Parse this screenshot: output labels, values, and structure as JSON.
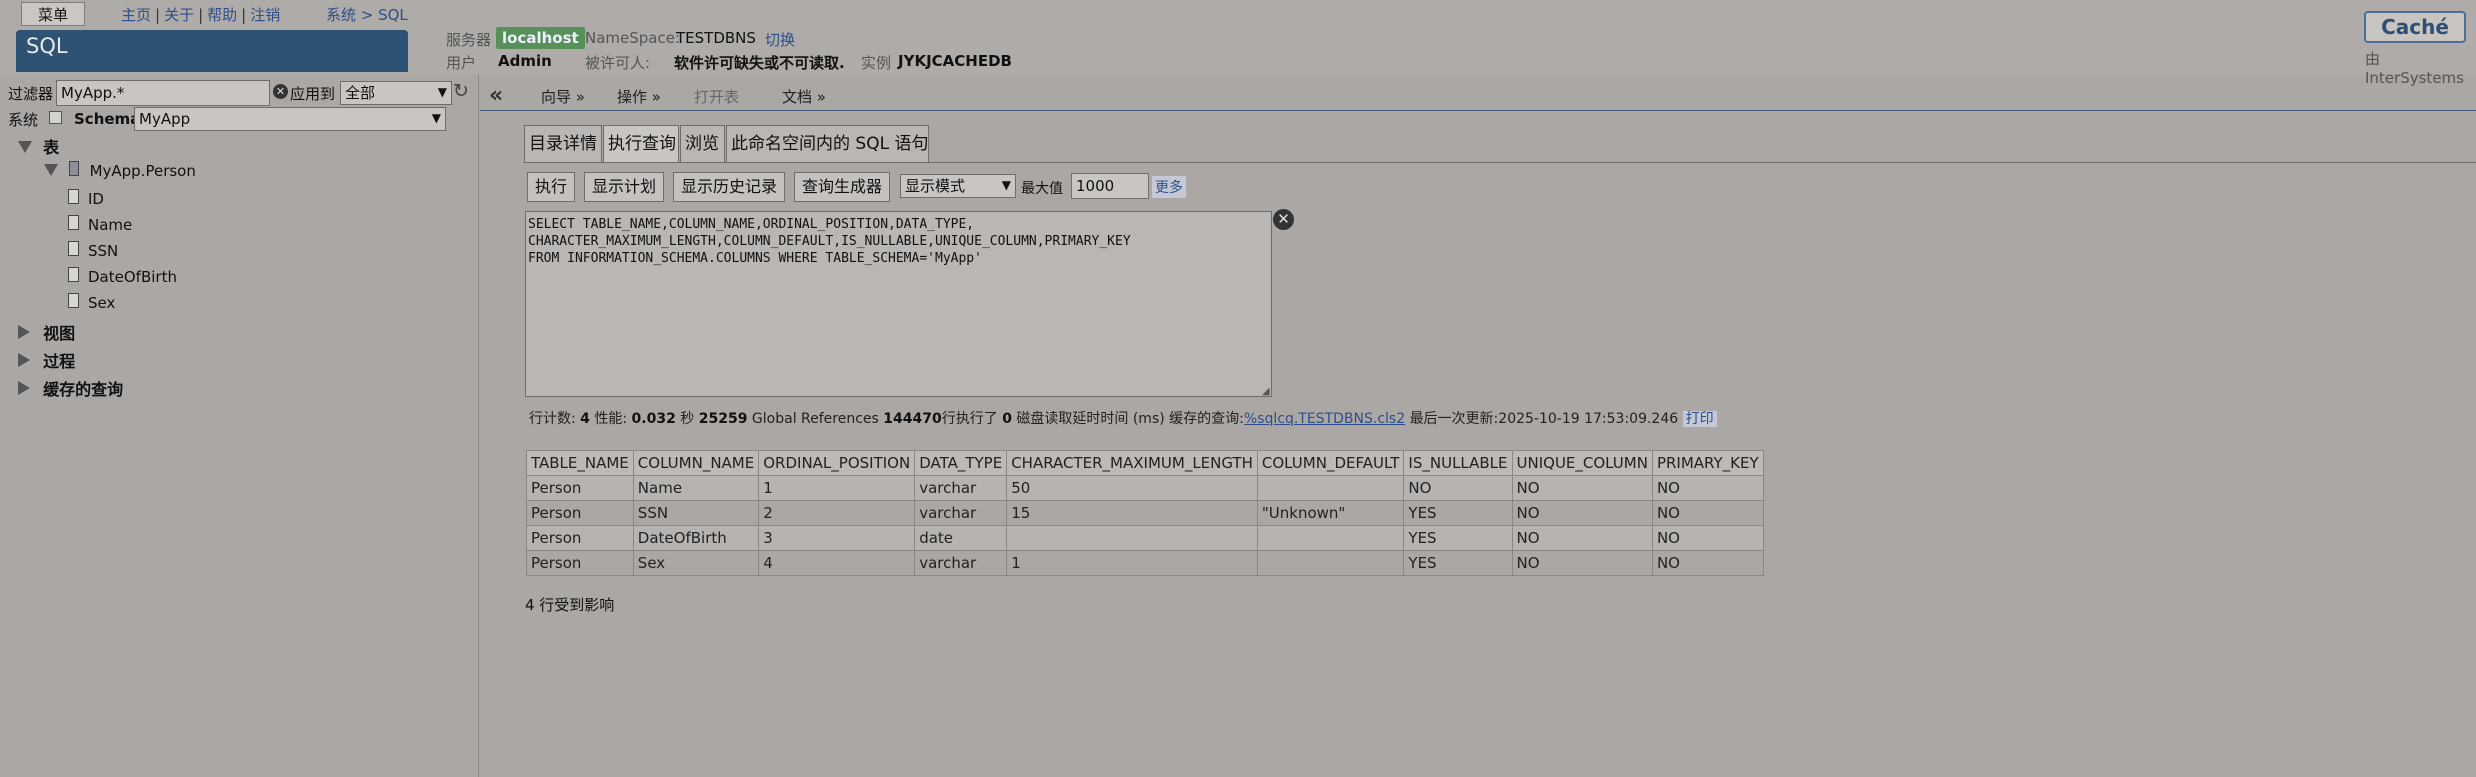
{
  "header": {
    "menu_label": "菜单",
    "nav": [
      "主页",
      "关于",
      "帮助",
      "注销"
    ],
    "breadcrumb": "系统 > SQL",
    "banner": "SQL",
    "server_label": "服务器",
    "server_value": "localhost",
    "namespace_label": "NameSpace:",
    "namespace_value": "TESTDBNS",
    "switch_link": "切换",
    "user_label": "用户",
    "user_value": "Admin",
    "licensee_label": "被许可人:",
    "licensee_value": "软件许可缺失或不可读取.",
    "instance_label": "实例",
    "instance_value": "JYKJCACHEDB",
    "brand": "Caché",
    "byline": "由InterSystems"
  },
  "left": {
    "filter_label": "过滤器",
    "filter_value": "MyApp.*",
    "apply_label": "应用到",
    "apply_value": "全部",
    "system_label": "系统",
    "schema_label": "Schema",
    "schema_value": "MyApp",
    "tree": {
      "tables": "表",
      "table_name": "MyApp.Person",
      "fields": [
        "ID",
        "Name",
        "SSN",
        "DateOfBirth",
        "Sex"
      ],
      "views": "视图",
      "procedures": "过程",
      "cached_queries": "缓存的查询"
    }
  },
  "main": {
    "menubar": [
      "向导 »",
      "操作 »",
      "打开表",
      "文档 »"
    ],
    "tabs": [
      "目录详情",
      "执行查询",
      "浏览",
      "此命名空间内的 SQL 语句"
    ],
    "buttons": {
      "execute": "执行",
      "show_plan": "显示计划",
      "show_history": "显示历史记录",
      "query_builder": "查询生成器"
    },
    "display_mode": "显示模式",
    "max_label": "最大值",
    "max_value": "1000",
    "more": "更多",
    "query": "SELECT TABLE_NAME,COLUMN_NAME,ORDINAL_POSITION,DATA_TYPE,\nCHARACTER_MAXIMUM_LENGTH,COLUMN_DEFAULT,IS_NULLABLE,UNIQUE_COLUMN,PRIMARY_KEY\nFROM INFORMATION_SCHEMA.COLUMNS WHERE TABLE_SCHEMA='MyApp'",
    "stats": {
      "rowcount_label": "行计数:",
      "rowcount": "4",
      "perf_label": "性能:",
      "perf": "0.032",
      "sec": "秒",
      "global_refs": "25259",
      "global_refs_label": "Global References",
      "lines_exec": "144470",
      "lines_exec_label": "行执行了",
      "disk_wait": "0",
      "disk_wait_label": "磁盘读取延时时间 (ms)",
      "cached_query_label": "缓存的查询:",
      "cached_query": "%sqlcq.TESTDBNS.cls2",
      "last_update_label": "最后一次更新:",
      "last_update": "2025-10-19 17:53:09.246",
      "print": "打印"
    },
    "table": {
      "columns": [
        "TABLE_NAME",
        "COLUMN_NAME",
        "ORDINAL_POSITION",
        "DATA_TYPE",
        "CHARACTER_MAXIMUM_LENGTH",
        "COLUMN_DEFAULT",
        "IS_NULLABLE",
        "UNIQUE_COLUMN",
        "PRIMARY_KEY"
      ],
      "rows": [
        [
          "Person",
          "Name",
          "1",
          "varchar",
          "50",
          "",
          "NO",
          "NO",
          "NO"
        ],
        [
          "Person",
          "SSN",
          "2",
          "varchar",
          "15",
          "\"Unknown\"",
          "YES",
          "NO",
          "NO"
        ],
        [
          "Person",
          "DateOfBirth",
          "3",
          "date",
          "",
          "",
          "YES",
          "NO",
          "NO"
        ],
        [
          "Person",
          "Sex",
          "4",
          "varchar",
          "1",
          "",
          "YES",
          "NO",
          "NO"
        ]
      ]
    },
    "rows_affected": "4 行受到影响"
  }
}
